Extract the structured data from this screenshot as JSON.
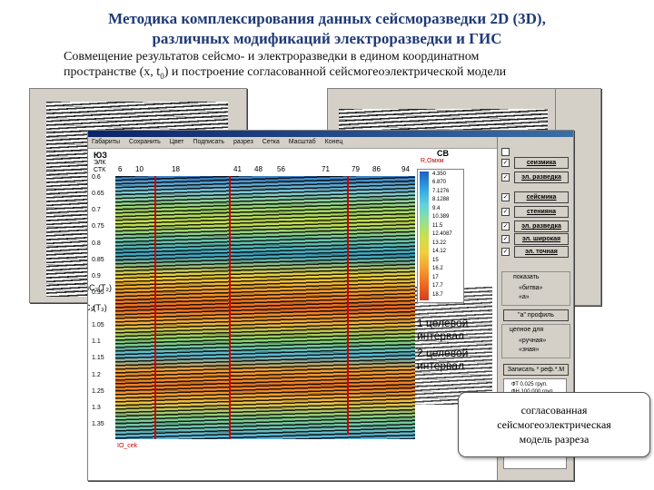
{
  "title_line1": "Методика комплексирования данных сейсморазведки 2D (3D),",
  "title_line2": "различных модификаций электроразведки и ГИС",
  "subtitle_line1": "Совмещение результатов сейсмо- и электроразведки в едином координатном",
  "subtitle_line2_pre": "пространстве (x, t",
  "subtitle_line2_sub": "0",
  "subtitle_line2_post": ") и построение согласованной сейсмогеоэлектрической модели",
  "main_window": {
    "menu": [
      "Габариты",
      "Сохранить",
      "Цвет",
      "Подписать",
      "разрез",
      "Сетка",
      "Масштаб",
      "Конец"
    ],
    "left_label": "ЮЗ",
    "right_label": "СВ",
    "row_labels": [
      "ЭЛК",
      "СТК"
    ],
    "trace_numbers": [
      "6",
      "10",
      "18",
      "41",
      "48",
      "56",
      "71",
      "79",
      "86",
      "94"
    ],
    "time_labels": [
      "0.6",
      "0.65",
      "0.7",
      "0.75",
      "0.8",
      "0.85",
      "0.9",
      "0.95",
      "1",
      "1.05",
      "1.1",
      "1.15",
      "1.2",
      "1.25",
      "1.3",
      "1.35"
    ],
    "horizon_labels": [
      "nC₂(T₂)",
      "C₁(T₃)"
    ],
    "interval1": [
      "1 целевой",
      "интервал"
    ],
    "interval2": [
      "2 целевой",
      "интервал"
    ],
    "bottom_label": "IO_cek",
    "legend_title": "R,Омхм",
    "legend_values": [
      "4.350",
      "6.870",
      "7.1276",
      "8.1288",
      "9.4",
      "10.389",
      "11.5",
      "12.4087",
      "13.22",
      "14.12",
      "15",
      "16.2",
      "17",
      "17.7",
      "18.7"
    ]
  },
  "side_panel": {
    "buttons": [
      "сеизмика",
      "эл. разведка",
      "сейсмика",
      "стенияна",
      "эл. разведка",
      "эл. широкая",
      "эл. точная"
    ],
    "radio_title": "показать",
    "radio_options": [
      "«битва»",
      "«а»"
    ],
    "profile_button": "\"а\" профиль",
    "tool_title": "цепное для",
    "tool_options": [
      "«ручная»",
      "«зная»"
    ],
    "bottom_button": "Записать * реф.*.М",
    "notes": [
      "ФТ 0.025 груп.",
      "ФН 100.000 груп."
    ]
  },
  "callout_lines": [
    "согласованная",
    "сейсмогеоэлектрическая",
    "модель разреза"
  ],
  "colors": {
    "title": "#1f3a75",
    "wells": "#d00000",
    "panel": "#d4d0c8"
  }
}
